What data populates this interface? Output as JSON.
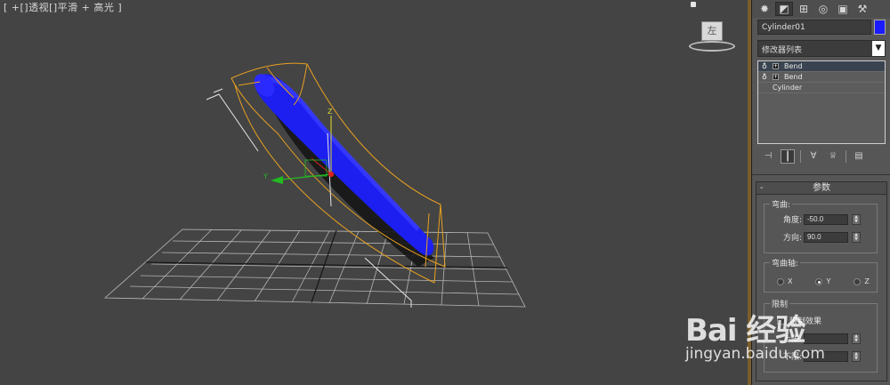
{
  "viewport": {
    "label": "[ +[]透视[]平滑 + 高光 ]",
    "viewcube_face": "左"
  },
  "panel": {
    "tabs": [
      {
        "icon": "sun-icon",
        "glyph": "✹"
      },
      {
        "icon": "curve-icon",
        "glyph": "◩"
      },
      {
        "icon": "hierarchy-icon",
        "glyph": "⊞"
      },
      {
        "icon": "motion-icon",
        "glyph": "◎"
      },
      {
        "icon": "display-icon",
        "glyph": "▣"
      },
      {
        "icon": "hammer-icon",
        "glyph": "⚒"
      }
    ],
    "object_name": "Cylinder01",
    "object_color": "#1b1bff",
    "modifier_list_label": "修改器列表",
    "stack_items": [
      {
        "label": "Bend",
        "selected": true
      },
      {
        "label": "Bend",
        "selected": false
      }
    ],
    "stack_base": "Cylinder",
    "params": {
      "title": "参数",
      "collapse": "-",
      "bend_group": "弯曲:",
      "angle_label": "角度:",
      "angle_value": "-50.0",
      "direction_label": "方向:",
      "direction_value": "90.0",
      "axis_group": "弯曲轴:",
      "axis_options": [
        "X",
        "Y",
        "Z"
      ],
      "axis_selected": "Y",
      "limit_group": "限制",
      "limit_effect": "限制效果",
      "upper_label": "上限:",
      "lower_label": "下限:"
    }
  },
  "watermark": {
    "logo": "Bai 经验",
    "url": "jingyan.baidu.com"
  },
  "colors": {
    "viewport_bg": "#444444",
    "cylinder": "#1b1bff",
    "gizmo": "#e8a020",
    "grid": "#bdbdbd"
  }
}
